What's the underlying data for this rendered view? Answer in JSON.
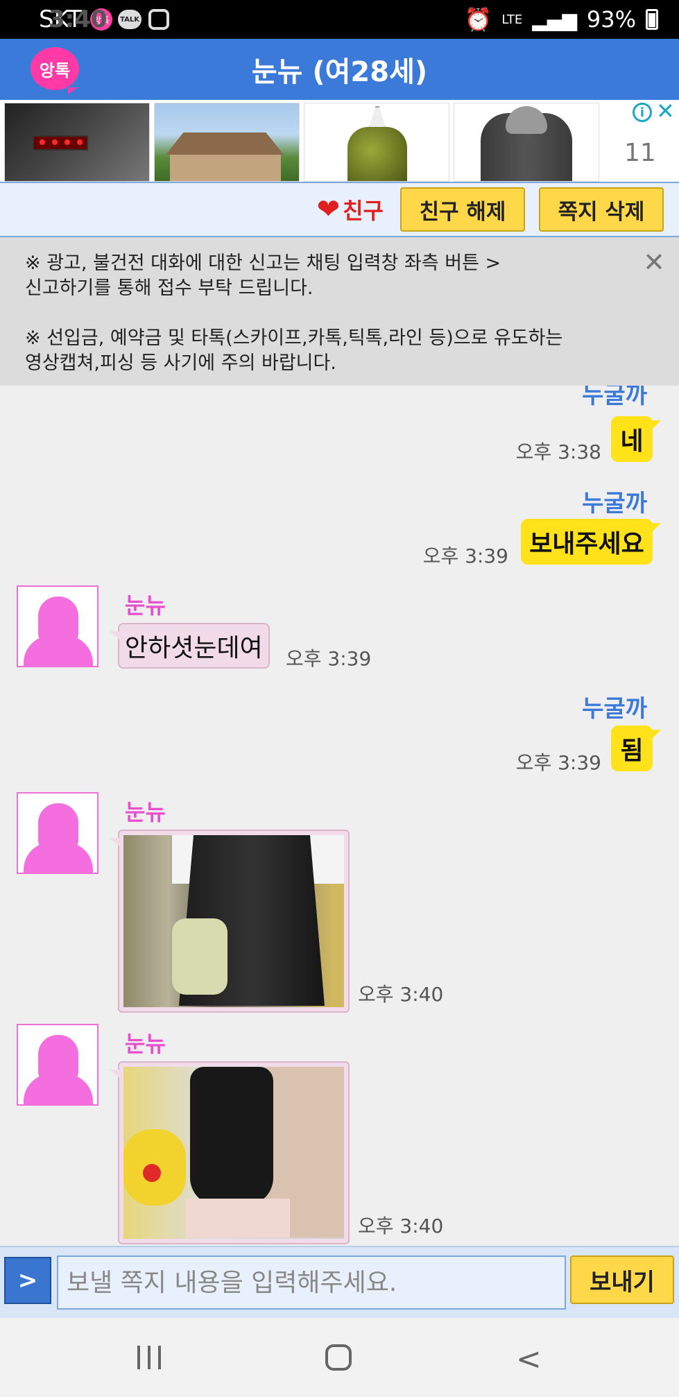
{
  "status_bar": {
    "carrier": "SKT",
    "time": "3:40",
    "app_badge": "앙톡",
    "talk_badge": "TALK",
    "network": "LTE",
    "battery": "93%"
  },
  "header": {
    "logo_text": "앙톡",
    "title": "눈뉴 (여28세)"
  },
  "ad": {
    "number": "11",
    "info_icon": "i",
    "close_icon": "✕"
  },
  "actions": {
    "heart": "❤",
    "friend_label": "친구",
    "unfriend_label": "친구 해제",
    "delete_label": "쪽지 삭제"
  },
  "notice": {
    "line1": "※ 광고, 불건전 대화에 대한 신고는 채팅 입력창 좌측 버튼 >\n신고하기를 통해 접수 부탁 드립니다.",
    "line2": "※ 선입금, 예약금 및 타톡(스카이프,카톡,틱톡,라인 등)으로 유도하는\n영상캡쳐,피싱 등 사기에 주의 바랍니다.",
    "close_icon": "✕"
  },
  "messages": [
    {
      "side": "right",
      "sender": "누굴까",
      "text": "네",
      "time": "오후 3:38"
    },
    {
      "side": "right",
      "sender": "누굴까",
      "text": "보내주세요",
      "time": "오후 3:39"
    },
    {
      "side": "left",
      "sender": "눈뉴",
      "text": "안하셧눈데여",
      "time": "오후 3:39"
    },
    {
      "side": "right",
      "sender": "누굴까",
      "text": "됨",
      "time": "오후 3:39"
    },
    {
      "side": "left",
      "sender": "눈뉴",
      "photo": true,
      "time": "오후 3:40"
    },
    {
      "side": "left",
      "sender": "눈뉴",
      "photo": true,
      "time": "오후 3:40"
    }
  ],
  "input": {
    "menu_label": ">",
    "placeholder": "보낼 쪽지 내용을 입력해주세요.",
    "send_label": "보내기"
  },
  "colors": {
    "header": "#3b7ad9",
    "my_bubble": "#ffe21a",
    "their_bubble": "#f2dbe9",
    "their_name": "#e84fd0",
    "my_name": "#3b7ad9"
  }
}
